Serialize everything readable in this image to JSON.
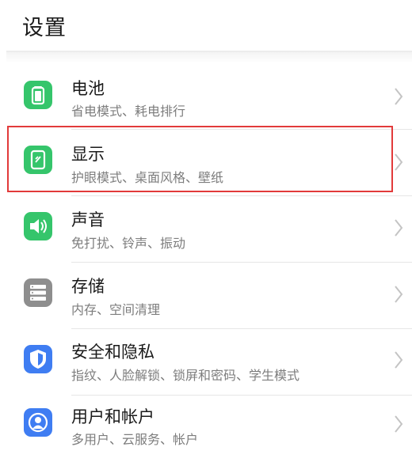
{
  "header": {
    "title": "设置"
  },
  "items": [
    {
      "label": "电池",
      "subtitle": "省电模式、耗电排行",
      "icon": "battery-icon",
      "icon_color": "#35c56b"
    },
    {
      "label": "显示",
      "subtitle": "护眼模式、桌面风格、壁纸",
      "icon": "display-icon",
      "icon_color": "#35c56b",
      "highlighted": true
    },
    {
      "label": "声音",
      "subtitle": "免打扰、铃声、振动",
      "icon": "speaker-icon",
      "icon_color": "#35c56b"
    },
    {
      "label": "存储",
      "subtitle": "内存、空间清理",
      "icon": "storage-icon",
      "icon_color": "#8e8e8e"
    },
    {
      "label": "安全和隐私",
      "subtitle": "指纹、人脸解锁、锁屏和密码、学生模式",
      "icon": "shield-icon",
      "icon_color": "#3f7df2"
    },
    {
      "label": "用户和帐户",
      "subtitle": "多用户、云服务、帐户",
      "icon": "user-account-icon",
      "icon_color": "#3f7df2"
    }
  ],
  "colors": {
    "highlight_border": "#e23a3a",
    "chevron": "#c4c4c4"
  }
}
